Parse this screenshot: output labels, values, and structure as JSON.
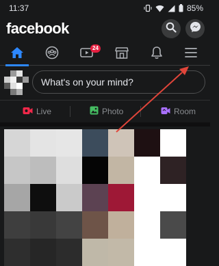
{
  "status_bar": {
    "time": "11:37",
    "battery": "85%"
  },
  "header": {
    "logo": "facebook"
  },
  "tabs": {
    "active": "home",
    "video_badge": "24"
  },
  "composer": {
    "placeholder": "What's on your mind?"
  },
  "actions": [
    {
      "label": "Live",
      "color": "#f02849"
    },
    {
      "label": "Photo",
      "color": "#45bd62"
    },
    {
      "label": "Room",
      "color": "#a970ff"
    }
  ],
  "annotation": {
    "arrow_color": "#e0453a"
  },
  "accent_color": "#2d88ff",
  "story_pixels": [
    [
      "#d6d6d6",
      "#e4e4e4",
      "#e6e6e6",
      "#3c4c5c",
      "#cfc4b8",
      "#1e1012",
      "#ffffff"
    ],
    [
      "#c6c6c6",
      "#bdbdbd",
      "#dedede",
      "#050505",
      "#c2b6a4",
      "#ffffff",
      "#2e2224"
    ],
    [
      "#a6a6a6",
      "#0e0e0e",
      "#cacaca",
      "#5c4252",
      "#9e1836",
      "#ffffff",
      "#ffffff"
    ],
    [
      "#3e3e3e",
      "#393939",
      "#434343",
      "#6e5448",
      "#c0b09c",
      "#ffffff",
      "#4a4a4a"
    ],
    [
      "#2e2e2e",
      "#262626",
      "#2c2c2c",
      "#bfb8a8",
      "#c2b9a8",
      "#ffffff",
      "#ffffff"
    ]
  ],
  "avatar_pixels": [
    [
      "#18191a",
      "#9a9a9a",
      "#e6e6e6",
      "#18191a"
    ],
    [
      "#cfcfcf",
      "#f2f2f2",
      "#3a3a3a",
      "#9a9a9a"
    ],
    [
      "#5a5a5a",
      "#e0e0e0",
      "#ffffff",
      "#18191a"
    ],
    [
      "#18191a",
      "#7a7a7a",
      "#b0b0b0",
      "#18191a"
    ]
  ]
}
